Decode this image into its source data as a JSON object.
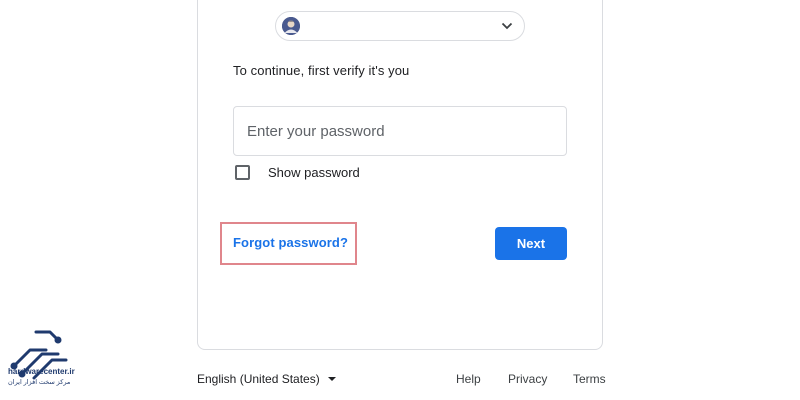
{
  "account": {
    "email": ""
  },
  "prompt": {
    "text": "To continue, first verify it's you"
  },
  "password": {
    "placeholder": "Enter your password",
    "value": ""
  },
  "show_password": {
    "label": "Show password",
    "checked": false
  },
  "forgot_password": {
    "label": "Forgot password?"
  },
  "next_button": {
    "label": "Next"
  },
  "footer": {
    "language": "English (United States)",
    "help": "Help",
    "privacy": "Privacy",
    "terms": "Terms"
  },
  "watermark": {
    "site": "hardwarecenter.ir",
    "tagline": "مرکز سخت افزار ایران"
  },
  "colors": {
    "accent": "#1a73e8",
    "highlight_border": "#e0868c",
    "border": "#dadce0",
    "brand_logo": "#1f3a6e"
  },
  "icons": {
    "avatar": "avatar-icon",
    "chevron": "chevron-down-icon",
    "checkbox": "checkbox-icon",
    "language_caret": "caret-down-icon",
    "logo": "circuit-logo-icon"
  }
}
